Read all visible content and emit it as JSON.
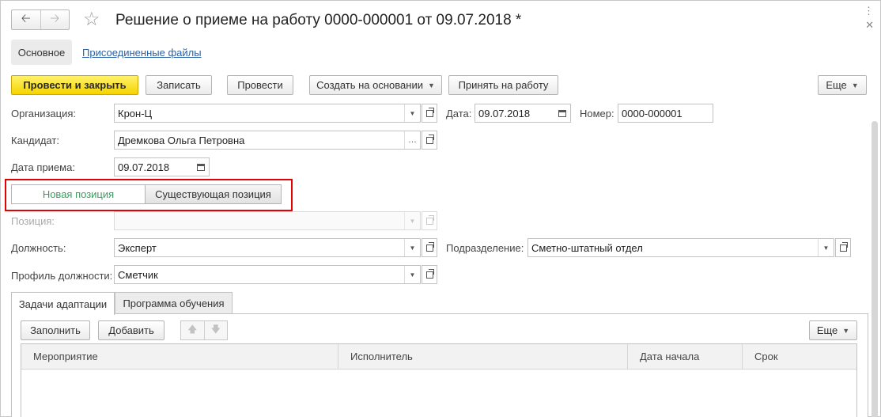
{
  "window": {
    "title": "Решение о приеме на работу 0000-000001 от 09.07.2018 *",
    "back_icon": "arrow-left",
    "forward_icon": "arrow-right",
    "favorite_icon": "star-outline",
    "more_icon": "vertical-dots",
    "close_icon": "close-x"
  },
  "sections": {
    "main": "Основное",
    "attached": "Присоединенные файлы"
  },
  "toolbar": {
    "post_close": "Провести и закрыть",
    "save": "Записать",
    "post": "Провести",
    "create_based": "Создать на основании",
    "hire": "Принять на работу",
    "more": "Еще"
  },
  "form": {
    "organization_label": "Организация:",
    "organization_value": "Крон-Ц",
    "date_label": "Дата:",
    "date_value": "09.07.2018",
    "number_label": "Номер:",
    "number_value": "0000-000001",
    "candidate_label": "Кандидат:",
    "candidate_value": "Дремкова Ольга Петровна",
    "hire_date_label": "Дата приема:",
    "hire_date_value": "09.07.2018",
    "new_position": "Новая позиция",
    "existing_position": "Существующая позиция",
    "position_label": "Позиция:",
    "position_value": "",
    "job_label": "Должность:",
    "job_value": "Эксперт",
    "department_label": "Подразделение:",
    "department_value": "Сметно-штатный отдел",
    "profile_label": "Профиль должности:",
    "profile_value": "Сметчик"
  },
  "tabs": {
    "adaptation": "Задачи адаптации",
    "training": "Программа обучения"
  },
  "table_toolbar": {
    "fill": "Заполнить",
    "add": "Добавить",
    "up_icon": "arrow-up",
    "down_icon": "arrow-down",
    "more": "Еще"
  },
  "table": {
    "columns": [
      "Мероприятие",
      "Исполнитель",
      "Дата начала",
      "Срок"
    ],
    "rows": []
  },
  "colors": {
    "primary_button": "#f5d400",
    "highlight_border": "#e30000",
    "toggle_active_text": "#3c9a5f",
    "link": "#2b62a4"
  }
}
